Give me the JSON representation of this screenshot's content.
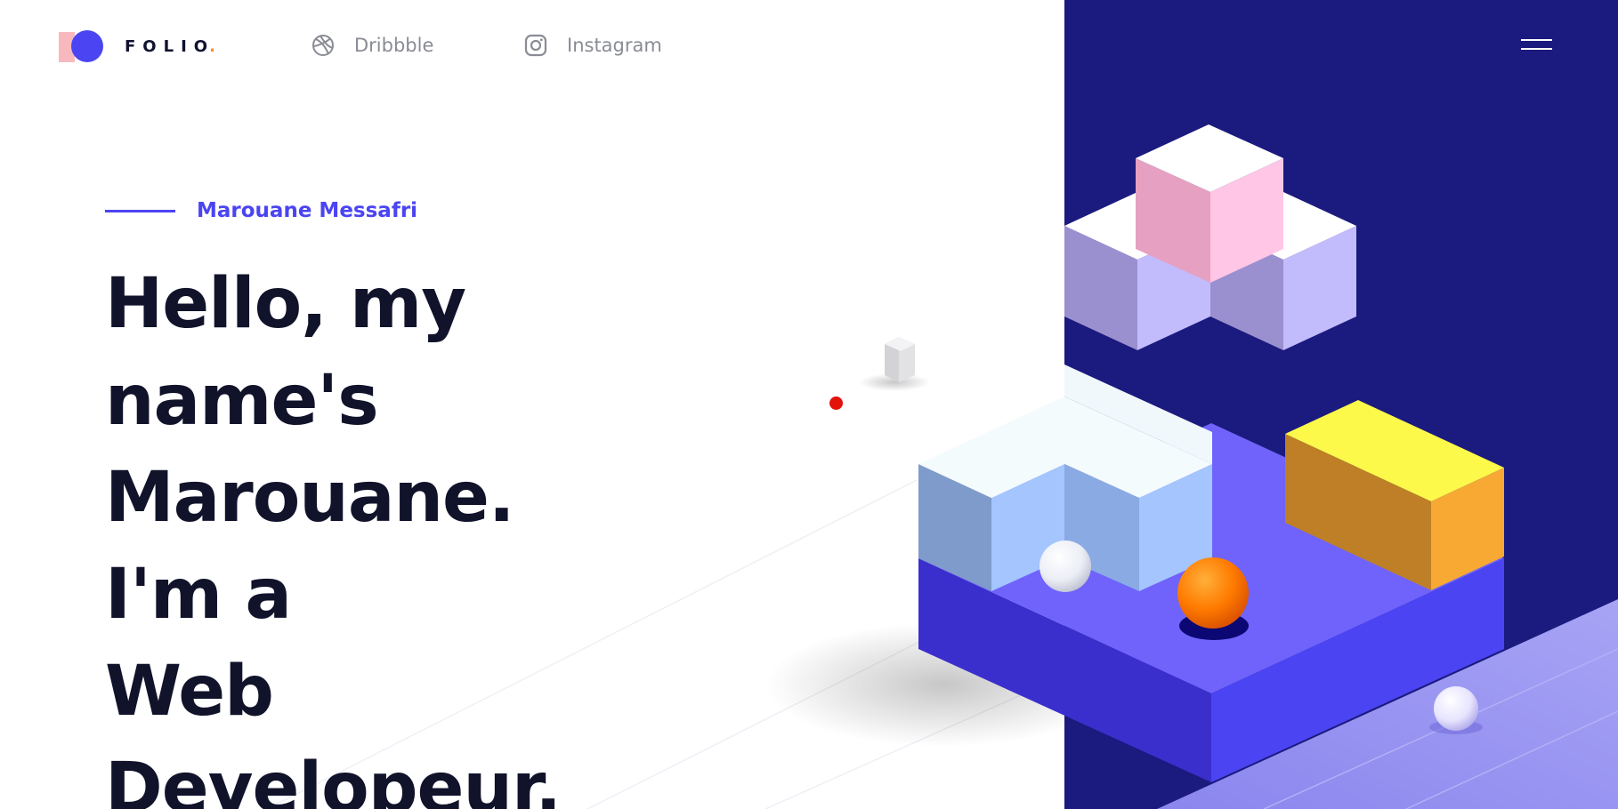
{
  "header": {
    "logo_text": "FOLIO",
    "logo_dot": ".",
    "social": [
      {
        "label": "Dribbble",
        "icon": "dribbble-icon"
      },
      {
        "label": "Instagram",
        "icon": "instagram-icon"
      }
    ],
    "menu_icon": "hamburger-menu-icon"
  },
  "hero": {
    "eyebrow": "Marouane Messafri",
    "lines": [
      "Hello, my",
      "name's",
      "Marouane.",
      "I'm a",
      "Web",
      "Developeur."
    ]
  },
  "colors": {
    "accent": "#4b44f2",
    "dark_panel": "#1b1a7e",
    "heading": "#11132b",
    "logo_pink": "#f7b9bd",
    "logo_dot": "#ff8a1f",
    "cursor_dot": "#e3120b"
  }
}
